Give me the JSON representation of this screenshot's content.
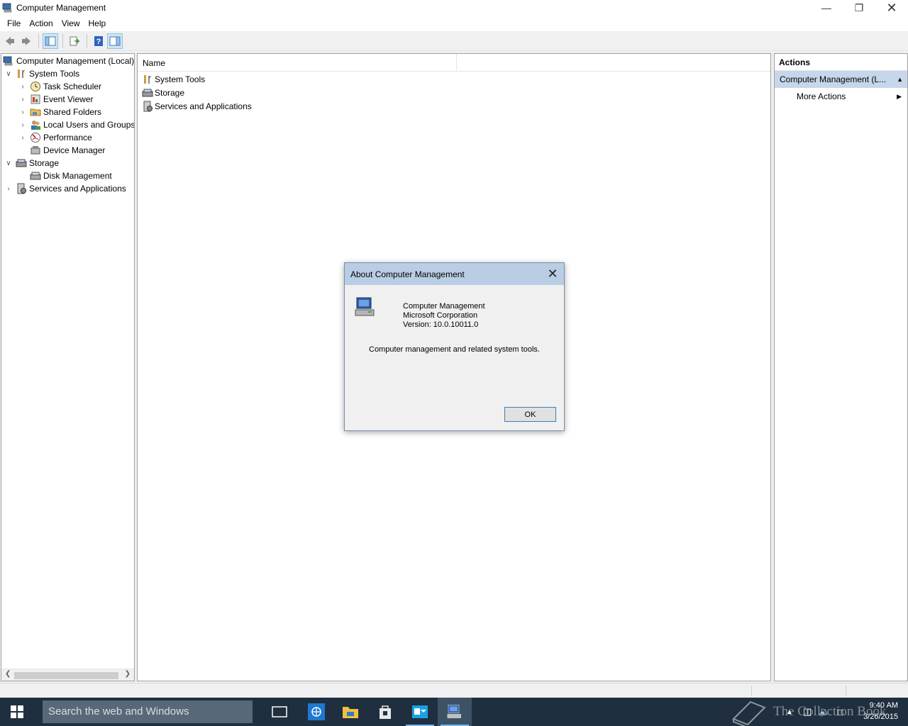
{
  "window": {
    "title": "Computer Management"
  },
  "menu": [
    "File",
    "Action",
    "View",
    "Help"
  ],
  "tree": {
    "root": "Computer Management (Local)",
    "system_tools": "System Tools",
    "task_scheduler": "Task Scheduler",
    "event_viewer": "Event Viewer",
    "shared_folders": "Shared Folders",
    "local_users": "Local Users and Groups",
    "performance": "Performance",
    "device_manager": "Device Manager",
    "storage": "Storage",
    "disk_management": "Disk Management",
    "services": "Services and Applications"
  },
  "list": {
    "header_name": "Name",
    "rows": [
      "System Tools",
      "Storage",
      "Services and Applications"
    ]
  },
  "actions": {
    "title": "Actions",
    "group": "Computer Management (L...",
    "more": "More Actions"
  },
  "dialog": {
    "title": "About Computer Management",
    "product": "Computer Management",
    "company": "Microsoft Corporation",
    "version": "Version: 10.0.10011.0",
    "description": "Computer management and related system tools.",
    "ok": "OK"
  },
  "taskbar": {
    "search_placeholder": "Search the web and Windows",
    "watermark": "The Collection Book",
    "time": "9:40 AM",
    "date": "3/26/2015"
  },
  "colors": {
    "dialog_title_bg": "#b9cde4",
    "actions_group_bg": "#c6d6eb",
    "taskbar_bg": "#1f2f3f"
  }
}
